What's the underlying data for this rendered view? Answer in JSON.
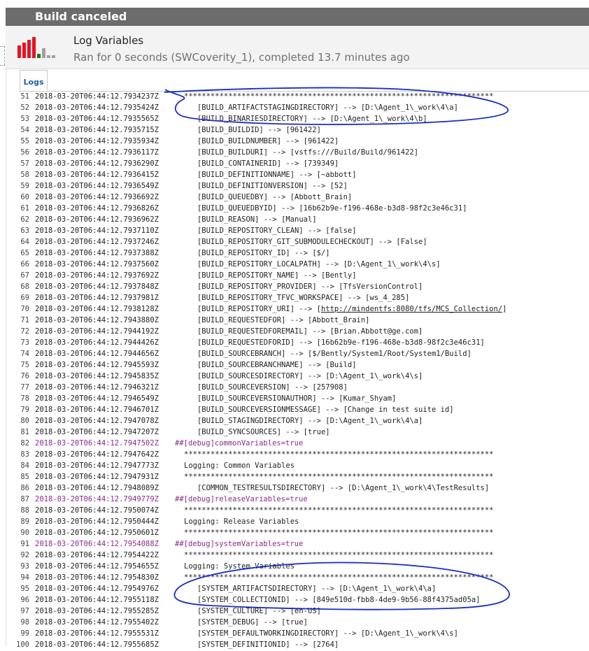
{
  "header": {
    "title": "Build canceled"
  },
  "summary": {
    "title": "Log Variables",
    "subtitle": "Ran for 0 seconds (SWCoverity_1), completed 13.7 minutes ago",
    "colors": {
      "fail": "#e81123",
      "success": "#107c10",
      "neutral": "#a0a0a0"
    }
  },
  "tabs": [
    {
      "label": "Logs"
    }
  ],
  "log": [
    {
      "n": "51",
      "ts": "2018-03-20T06:44:12.7934237Z",
      "msg": "**********************************************************************"
    },
    {
      "n": "52",
      "ts": "2018-03-20T06:44:12.7935424Z",
      "msg": "   [BUILD_ARTIFACTSTAGINGDIRECTORY] --> [D:\\Agent_1\\_work\\4\\a]"
    },
    {
      "n": "53",
      "ts": "2018-03-20T06:44:12.7935565Z",
      "msg": "   [BUILD_BINARIESDIRECTORY] --> [D:\\Agent_1\\_work\\4\\b]"
    },
    {
      "n": "54",
      "ts": "2018-03-20T06:44:12.7935715Z",
      "msg": "   [BUILD_BUILDID] --> [961422]"
    },
    {
      "n": "55",
      "ts": "2018-03-20T06:44:12.7935934Z",
      "msg": "   [BUILD_BUILDNUMBER] --> [961422]"
    },
    {
      "n": "56",
      "ts": "2018-03-20T06:44:12.7936117Z",
      "msg": "   [BUILD_BUILDURI] --> [vstfs:///Build/Build/961422]"
    },
    {
      "n": "57",
      "ts": "2018-03-20T06:44:12.7936290Z",
      "msg": "   [BUILD_CONTAINERID] --> [739349]"
    },
    {
      "n": "58",
      "ts": "2018-03-20T06:44:12.7936415Z",
      "msg": "   [BUILD_DEFINITIONNAME] --> [~abbott]"
    },
    {
      "n": "59",
      "ts": "2018-03-20T06:44:12.7936549Z",
      "msg": "   [BUILD_DEFINITIONVERSION] --> [52]"
    },
    {
      "n": "60",
      "ts": "2018-03-20T06:44:12.7936692Z",
      "msg": "   [BUILD_QUEUEDBY] --> [Abbott_Brain]"
    },
    {
      "n": "61",
      "ts": "2018-03-20T06:44:12.7936826Z",
      "msg": "   [BUILD_QUEUEDBYID] --> [16b62b9e-f196-468e-b3d8-98f2c3e46c31]"
    },
    {
      "n": "62",
      "ts": "2018-03-20T06:44:12.7936962Z",
      "msg": "   [BUILD_REASON] --> [Manual]"
    },
    {
      "n": "63",
      "ts": "2018-03-20T06:44:12.7937110Z",
      "msg": "   [BUILD_REPOSITORY_CLEAN] --> [false]"
    },
    {
      "n": "64",
      "ts": "2018-03-20T06:44:12.7937246Z",
      "msg": "   [BUILD_REPOSITORY_GIT_SUBMODULECHECKOUT] --> [False]"
    },
    {
      "n": "65",
      "ts": "2018-03-20T06:44:12.7937388Z",
      "msg": "   [BUILD_REPOSITORY_ID] --> [$/]"
    },
    {
      "n": "66",
      "ts": "2018-03-20T06:44:12.7937560Z",
      "msg": "   [BUILD_REPOSITORY_LOCALPATH] --> [D:\\Agent_1\\_work\\4\\s]"
    },
    {
      "n": "67",
      "ts": "2018-03-20T06:44:12.7937692Z",
      "msg": "   [BUILD_REPOSITORY_NAME] --> [Bently]"
    },
    {
      "n": "68",
      "ts": "2018-03-20T06:44:12.7937848Z",
      "msg": "   [BUILD_REPOSITORY_PROVIDER] --> [TfsVersionControl]"
    },
    {
      "n": "69",
      "ts": "2018-03-20T06:44:12.7937981Z",
      "msg": "   [BUILD_REPOSITORY_TFVC_WORKSPACE] --> [ws_4_285]"
    },
    {
      "n": "70",
      "ts": "2018-03-20T06:44:12.7938128Z",
      "msg": "   [BUILD_REPOSITORY_URI] --> [",
      "link": "http://mindentfs:8080/tfs/MCS_Collection/",
      "tail": "]"
    },
    {
      "n": "71",
      "ts": "2018-03-20T06:44:12.7943880Z",
      "msg": "   [BUILD_REQUESTEDFOR] --> [Abbott_Brain]"
    },
    {
      "n": "72",
      "ts": "2018-03-20T06:44:12.7944192Z",
      "msg": "   [BUILD_REQUESTEDFOREMAIL] --> [Brian.Abbott@ge.com]"
    },
    {
      "n": "73",
      "ts": "2018-03-20T06:44:12.7944426Z",
      "msg": "   [BUILD_REQUESTEDFORID] --> [16b62b9e-f196-468e-b3d8-98f2c3e46c31]"
    },
    {
      "n": "74",
      "ts": "2018-03-20T06:44:12.7944656Z",
      "msg": "   [BUILD_SOURCEBRANCH] --> [$/Bently/System1/Root/System1/Build]"
    },
    {
      "n": "75",
      "ts": "2018-03-20T06:44:12.7945593Z",
      "msg": "   [BUILD_SOURCEBRANCHNAME] --> [Build]"
    },
    {
      "n": "76",
      "ts": "2018-03-20T06:44:12.7945835Z",
      "msg": "   [BUILD_SOURCESDIRECTORY] --> [D:\\Agent_1\\_work\\4\\s]"
    },
    {
      "n": "77",
      "ts": "2018-03-20T06:44:12.7946321Z",
      "msg": "   [BUILD_SOURCEVERSION] --> [257908]"
    },
    {
      "n": "78",
      "ts": "2018-03-20T06:44:12.7946549Z",
      "msg": "   [BUILD_SOURCEVERSIONAUTHOR] --> [Kumar_Shyam]"
    },
    {
      "n": "79",
      "ts": "2018-03-20T06:44:12.7946701Z",
      "msg": "   [BUILD_SOURCEVERSIONMESSAGE] --> [Change in test suite id]"
    },
    {
      "n": "80",
      "ts": "2018-03-20T06:44:12.7947078Z",
      "msg": "   [BUILD_STAGINGDIRECTORY] --> [D:\\Agent_1\\_work\\4\\a]"
    },
    {
      "n": "81",
      "ts": "2018-03-20T06:44:12.7947207Z",
      "msg": "   [BUILD_SYNCSOURCES] --> [true]"
    },
    {
      "n": "82",
      "ts": "2018-03-20T06:44:12.7947502Z",
      "msg": "##[debug]commonVariables=true",
      "debug": true
    },
    {
      "n": "83",
      "ts": "2018-03-20T06:44:12.7947642Z",
      "msg": "**********************************************************************"
    },
    {
      "n": "84",
      "ts": "2018-03-20T06:44:12.7947773Z",
      "msg": "Logging: Common Variables"
    },
    {
      "n": "85",
      "ts": "2018-03-20T06:44:12.7947931Z",
      "msg": "**********************************************************************"
    },
    {
      "n": "86",
      "ts": "2018-03-20T06:44:12.7948089Z",
      "msg": "   [COMMON_TESTRESULTSDIRECTORY] --> [D:\\Agent_1\\_work\\4\\TestResults]"
    },
    {
      "n": "87",
      "ts": "2018-03-20T06:44:12.7949779Z",
      "msg": "##[debug]releaseVariables=true",
      "debug": true
    },
    {
      "n": "88",
      "ts": "2018-03-20T06:44:12.7950074Z",
      "msg": "**********************************************************************"
    },
    {
      "n": "89",
      "ts": "2018-03-20T06:44:12.7950444Z",
      "msg": "Logging: Release Variables"
    },
    {
      "n": "90",
      "ts": "2018-03-20T06:44:12.7950601Z",
      "msg": "**********************************************************************"
    },
    {
      "n": "91",
      "ts": "2018-03-20T06:44:12.7954088Z",
      "msg": "##[debug]systemVariables=true",
      "debug": true
    },
    {
      "n": "92",
      "ts": "2018-03-20T06:44:12.7954422Z",
      "msg": "**********************************************************************"
    },
    {
      "n": "93",
      "ts": "2018-03-20T06:44:12.7954655Z",
      "msg": "Logging: System Variables"
    },
    {
      "n": "94",
      "ts": "2018-03-20T06:44:12.7954830Z",
      "msg": "**********************************************************************"
    },
    {
      "n": "95",
      "ts": "2018-03-20T06:44:12.7954976Z",
      "msg": "   [SYSTEM_ARTIFACTSDIRECTORY] --> [D:\\Agent_1\\_work\\4\\a]"
    },
    {
      "n": "96",
      "ts": "2018-03-20T06:44:12.7955118Z",
      "msg": "   [SYSTEM_COLLECTIONID] --> [849e510d-fbb8-4de9-9b56-88f4375ad05a]"
    },
    {
      "n": "97",
      "ts": "2018-03-20T06:44:12.7955285Z",
      "msg": "   [SYSTEM_CULTURE] --> [en-US]"
    },
    {
      "n": "98",
      "ts": "2018-03-20T06:44:12.7955402Z",
      "msg": "   [SYSTEM_DEBUG] --> [true]"
    },
    {
      "n": "99",
      "ts": "2018-03-20T06:44:12.7955531Z",
      "msg": "   [SYSTEM_DEFAULTWORKINGDIRECTORY] --> [D:\\Agent_1\\_work\\4\\s]"
    },
    {
      "n": "100",
      "ts": "2018-03-20T06:44:12.7955685Z",
      "msg": "   [SYSTEM_DEFINITIONID] --> [2764]"
    }
  ]
}
